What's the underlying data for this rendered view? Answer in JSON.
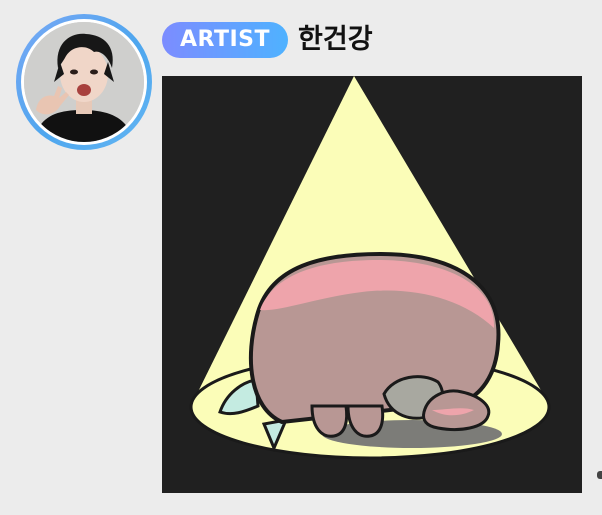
{
  "message": {
    "badge": "ARTIST",
    "author": "한건강",
    "avatar_icon": "profile-photo-icon",
    "sticker_icon": "spotlight-bunny-sticker-icon",
    "accent_colors": {
      "ring": "#4ea6ee",
      "badge_start": "#7c8cff",
      "badge_end": "#4fb2ff",
      "sticker_background": "#202020"
    }
  }
}
